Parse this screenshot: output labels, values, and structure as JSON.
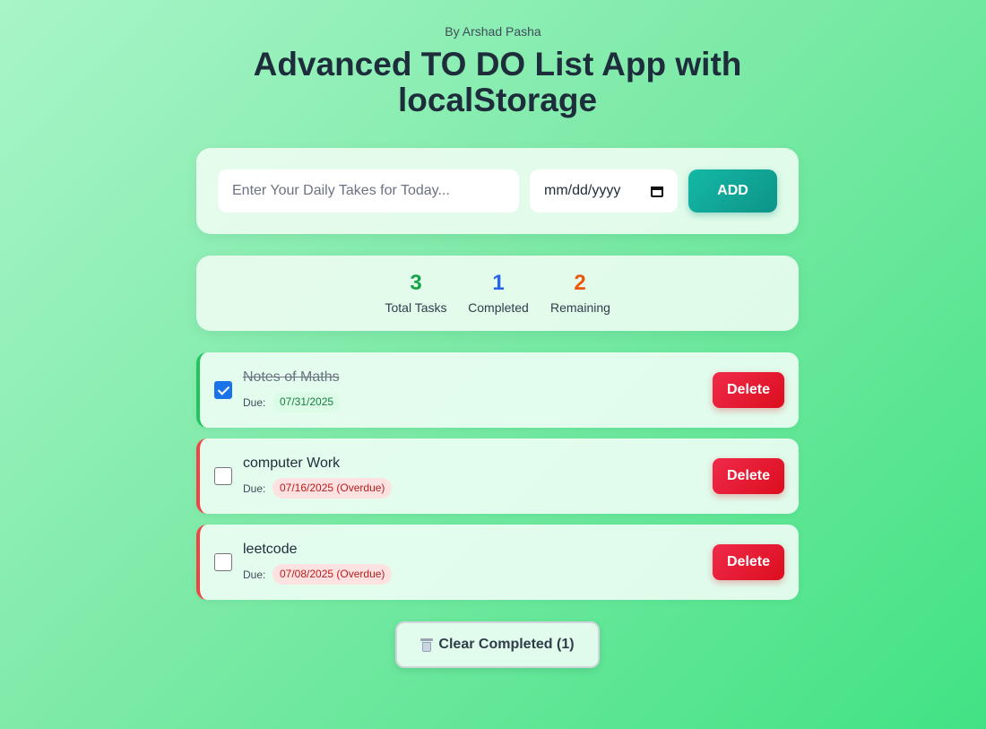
{
  "header": {
    "author": "By Arshad Pasha",
    "title": "Advanced TO DO List App with localStorage"
  },
  "form": {
    "task_placeholder": "Enter Your Daily Takes for Today...",
    "task_value": "",
    "date_placeholder": "mm/dd/yyyy",
    "add_label": "ADD"
  },
  "stats": {
    "total": "3",
    "total_label": "Total Tasks",
    "completed": "1",
    "completed_label": "Completed",
    "remaining": "2",
    "remaining_label": "Remaining"
  },
  "tasks": [
    {
      "name": "Notes of Maths",
      "completed": true,
      "due_label": "Due:",
      "due": "07/31/2025",
      "delete_label": "Delete"
    },
    {
      "name": "computer Work",
      "completed": false,
      "due_label": "Due:",
      "due": "07/16/2025 (Overdue)",
      "delete_label": "Delete"
    },
    {
      "name": "leetcode",
      "completed": false,
      "due_label": "Due:",
      "due": "07/08/2025 (Overdue)",
      "delete_label": "Delete"
    }
  ],
  "clear_completed": {
    "label": "Clear Completed (1)",
    "icon": "trash-icon"
  },
  "colors": {
    "accent": "#0d9488",
    "danger": "#dc0e1e",
    "total": "#16a34a",
    "completed": "#2563eb",
    "remaining": "#ea580c"
  }
}
